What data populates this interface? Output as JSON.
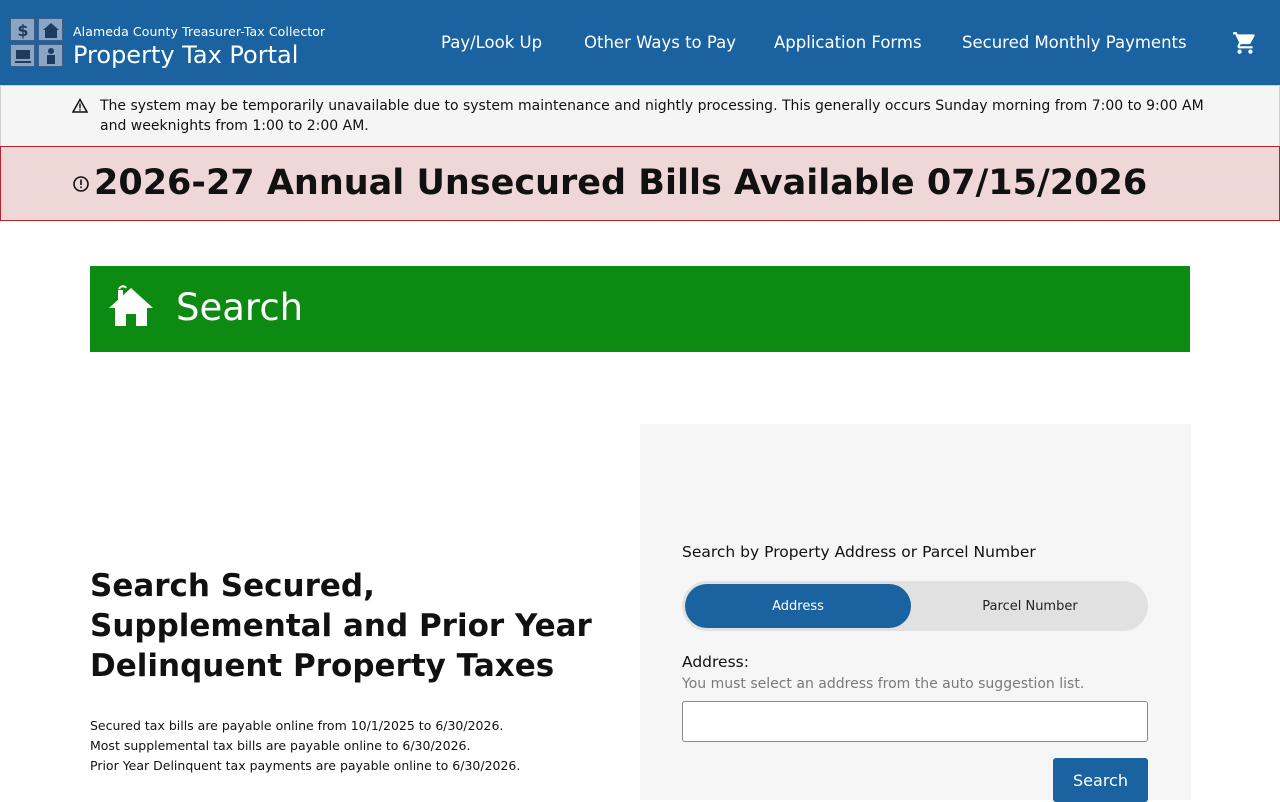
{
  "header": {
    "org": "Alameda County Treasurer-Tax Collector",
    "title": "Property Tax Portal",
    "nav": [
      {
        "label": "Pay/Look Up"
      },
      {
        "label": "Other Ways to Pay"
      },
      {
        "label": "Application Forms"
      },
      {
        "label": "Secured Monthly Payments"
      }
    ],
    "cart_icon": "shopping-cart-icon",
    "logo_icons": [
      "dollar-icon",
      "house-icon",
      "computer-icon",
      "person-icon"
    ]
  },
  "maintenance": {
    "icon": "warning-icon",
    "text": "The system may be temporarily unavailable due to system maintenance and nightly processing. This generally occurs Sunday morning from 7:00 to 9:00 AM and weeknights from 1:00 to 2:00 AM."
  },
  "alert": {
    "icon": "exclamation-circle-icon",
    "text": "2026-27 Annual Unsecured Bills Available 07/15/2026"
  },
  "search_banner": {
    "icon": "home-icon",
    "title": "Search"
  },
  "intro": {
    "heading": "Search Secured, Supplemental and Prior Year Delinquent Property Taxes",
    "notes": [
      "Secured tax bills are payable online from 10/1/2025 to 6/30/2026.",
      "Most supplemental tax bills are payable online to 6/30/2026.",
      "Prior Year Delinquent tax payments are payable online to 6/30/2026."
    ]
  },
  "search_panel": {
    "label": "Search by Property Address or Parcel Number",
    "toggle": {
      "options": [
        {
          "label": "Address"
        },
        {
          "label": "Parcel Number"
        }
      ],
      "selected": "Address"
    },
    "address_label": "Address:",
    "hint": "You must select an address from the auto suggestion list.",
    "address_value": "",
    "search_button": "Search"
  },
  "colors": {
    "header_blue": "#1a63a0",
    "alert_bg": "#efd7d8",
    "alert_border": "#b0262b",
    "banner_green": "#0d8a12",
    "panel_bg": "#f6f6f6"
  }
}
